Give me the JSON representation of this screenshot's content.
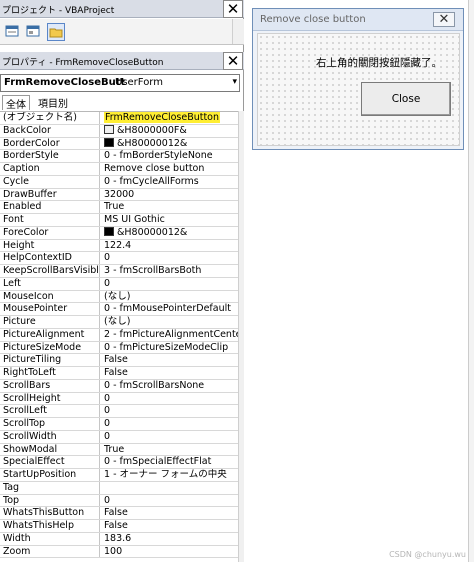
{
  "project_window": {
    "title": "プロジェクト - VBAProject"
  },
  "properties_window": {
    "title": "プロパティ - FrmRemoveCloseButton",
    "object_name": "FrmRemoveCloseButt",
    "object_type": "UserForm",
    "tabs": [
      {
        "label": "全体"
      },
      {
        "label": "項目別"
      }
    ],
    "properties": [
      {
        "name": "(オブジェクト名)",
        "value": "FrmRemoveCloseButton"
      },
      {
        "name": "BackColor",
        "value": "&H8000000F&"
      },
      {
        "name": "BorderColor",
        "value": "&H80000012&"
      },
      {
        "name": "BorderStyle",
        "value": "0 - fmBorderStyleNone"
      },
      {
        "name": "Caption",
        "value": "Remove close button"
      },
      {
        "name": "Cycle",
        "value": "0 - fmCycleAllForms"
      },
      {
        "name": "DrawBuffer",
        "value": "32000"
      },
      {
        "name": "Enabled",
        "value": "True"
      },
      {
        "name": "Font",
        "value": "MS UI Gothic"
      },
      {
        "name": "ForeColor",
        "value": "&H80000012&"
      },
      {
        "name": "Height",
        "value": "122.4"
      },
      {
        "name": "HelpContextID",
        "value": "0"
      },
      {
        "name": "KeepScrollBarsVisible",
        "value": "3 - fmScrollBarsBoth"
      },
      {
        "name": "Left",
        "value": "0"
      },
      {
        "name": "MouseIcon",
        "value": "(なし)"
      },
      {
        "name": "MousePointer",
        "value": "0 - fmMousePointerDefault"
      },
      {
        "name": "Picture",
        "value": "(なし)"
      },
      {
        "name": "PictureAlignment",
        "value": "2 - fmPictureAlignmentCente"
      },
      {
        "name": "PictureSizeMode",
        "value": "0 - fmPictureSizeModeClip"
      },
      {
        "name": "PictureTiling",
        "value": "False"
      },
      {
        "name": "RightToLeft",
        "value": "False"
      },
      {
        "name": "ScrollBars",
        "value": "0 - fmScrollBarsNone"
      },
      {
        "name": "ScrollHeight",
        "value": "0"
      },
      {
        "name": "ScrollLeft",
        "value": "0"
      },
      {
        "name": "ScrollTop",
        "value": "0"
      },
      {
        "name": "ScrollWidth",
        "value": "0"
      },
      {
        "name": "ShowModal",
        "value": "True"
      },
      {
        "name": "SpecialEffect",
        "value": "0 - fmSpecialEffectFlat"
      },
      {
        "name": "StartUpPosition",
        "value": "1 - オーナー フォームの中央"
      },
      {
        "name": "Tag",
        "value": ""
      },
      {
        "name": "Top",
        "value": "0"
      },
      {
        "name": "WhatsThisButton",
        "value": "False"
      },
      {
        "name": "WhatsThisHelp",
        "value": "False"
      },
      {
        "name": "Width",
        "value": "183.6"
      },
      {
        "name": "Zoom",
        "value": "100"
      }
    ]
  },
  "colors": {
    "highlight": "#ffee33",
    "backcolor_swatch": "#f0f0f0",
    "bordercolor_swatch": "#000000",
    "forecolor_swatch": "#000000"
  },
  "userform": {
    "title": "Remove close button",
    "close_x": "✕",
    "message": "右上角的關閉按鈕隱藏了。",
    "button_label": "Close"
  },
  "watermark": "CSDN @chunyu.wu"
}
